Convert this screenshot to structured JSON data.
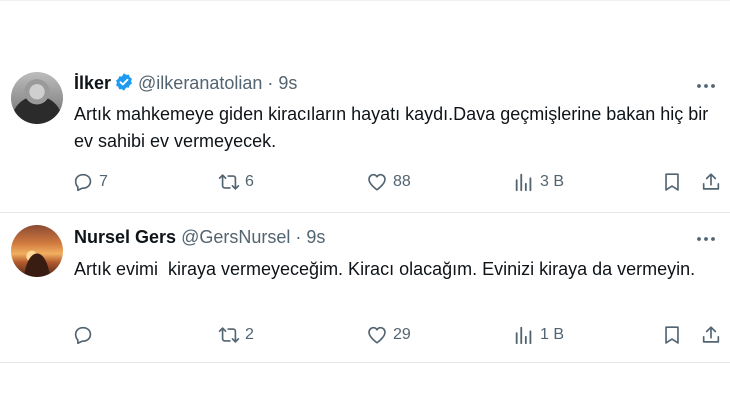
{
  "tweets": [
    {
      "name": "İlker",
      "handle": "@ilkeranatolian",
      "separator": "·",
      "time": "9s",
      "verified": true,
      "text": "Artık mahkemeye giden kiracıların hayatı kaydı.Dava geçmişlerine bakan hiç bir ev sahibi ev vermeyecek.",
      "replies": "7",
      "retweets": "6",
      "likes": "88",
      "views": "3 B"
    },
    {
      "name": "Nursel Gers",
      "handle": "@GersNursel",
      "separator": "·",
      "time": "9s",
      "verified": false,
      "text": "Artık evimi  kiraya vermeyeceğim. Kiracı olacağım. Evinizi kiraya da vermeyin.",
      "replies": "",
      "retweets": "2",
      "likes": "29",
      "views": "1 B"
    }
  ],
  "colors": {
    "text": "#0f1419",
    "secondary": "#536471",
    "verified": "#1d9bf0",
    "divider": "#e3e7ea"
  },
  "icons": [
    "reply-icon",
    "retweet-icon",
    "like-icon",
    "views-icon",
    "bookmark-icon",
    "share-icon",
    "more-icon",
    "verified-badge-icon"
  ]
}
